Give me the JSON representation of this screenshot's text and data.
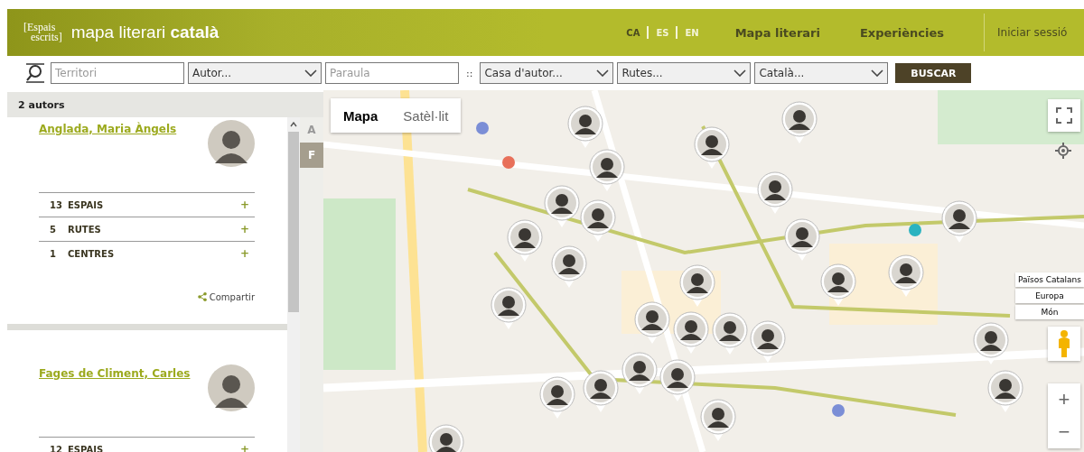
{
  "header": {
    "logo": {
      "line_1": "[Espais",
      "line_2": "escrits]"
    },
    "title": "mapa literari",
    "title_bold": "català",
    "languages": [
      {
        "label": "CA",
        "selected": true
      },
      {
        "label": "ES",
        "selected": false
      },
      {
        "label": "EN",
        "selected": false
      }
    ],
    "nav": [
      "Mapa literari",
      "Experiències"
    ],
    "login": "Iniciar sessió"
  },
  "search": [
    {
      "kind": "input",
      "placeholder": "Territori"
    },
    {
      "kind": "select",
      "value": "Autor..."
    },
    {
      "kind": "input",
      "placeholder": "Paraula"
    },
    {
      "kind": "separator",
      "text": "::"
    },
    {
      "kind": "select",
      "value": "Casa d'autor..."
    },
    {
      "kind": "select",
      "value": "Rutes..."
    },
    {
      "kind": "select",
      "value": "Català..."
    },
    {
      "kind": "button",
      "text": "BUSCAR"
    }
  ],
  "sidebar": {
    "count": "2 autors",
    "authors": [
      {
        "name": "Anglada, Maria Àngels",
        "stats": [
          {
            "count": "13",
            "label": "ESPAIS",
            "action": "+"
          },
          {
            "count": "5",
            "label": "RUTES",
            "action": "+"
          },
          {
            "count": "1",
            "label": "CENTRES",
            "action": "+"
          }
        ],
        "share": "Compartir"
      },
      {
        "name": "Fages de Climent, Carles",
        "stats": [
          {
            "count": "12",
            "label": "ESPAIS",
            "action": "+"
          }
        ]
      }
    ],
    "letters": [
      {
        "label": "A",
        "selected": false
      },
      {
        "label": "F",
        "selected": true
      }
    ]
  },
  "map": {
    "kind": "picture",
    "type_tabs": [
      {
        "label": "Mapa",
        "selected": true
      },
      {
        "label": "Satèl·lit",
        "selected": false
      }
    ],
    "regions": [
      "Països Catalans",
      "Europa",
      "Món"
    ],
    "zoom": [
      "+",
      "−"
    ]
  }
}
